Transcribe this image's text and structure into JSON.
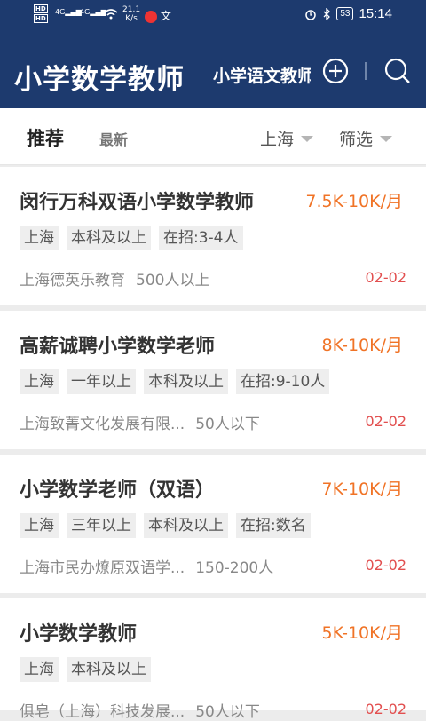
{
  "status_bar": {
    "hd1": "HD",
    "hd2": "HD",
    "signal1": "4G",
    "signal2": "4G",
    "speed_value": "21.1",
    "speed_unit": "K/s",
    "battery": "53",
    "time": "15:14"
  },
  "header": {
    "title": "小学数学教师",
    "subtab": "小学语文教师"
  },
  "filters": {
    "tab_recommend": "推荐",
    "tab_latest": "最新",
    "city": "上海",
    "filter": "筛选"
  },
  "jobs": [
    {
      "title": "闵行万科双语小学数学教师",
      "salary": "7.5K-10K/月",
      "tags": [
        "上海",
        "本科及以上",
        "在招:3-4人"
      ],
      "company": "上海德英乐教育",
      "size": "500人以上",
      "date": "02-02"
    },
    {
      "title": "高薪诚聘小学数学老师",
      "salary": "8K-10K/月",
      "tags": [
        "上海",
        "一年以上",
        "本科及以上",
        "在招:9-10人"
      ],
      "company": "上海致菁文化发展有限...",
      "size": "50人以下",
      "date": "02-02"
    },
    {
      "title": "小学数学老师（双语）",
      "salary": "7K-10K/月",
      "tags": [
        "上海",
        "三年以上",
        "本科及以上",
        "在招:数名"
      ],
      "company": "上海市民办燎原双语学...",
      "size": "150-200人",
      "date": "02-02"
    },
    {
      "title": "小学数学教师",
      "salary": "5K-10K/月",
      "tags": [
        "上海",
        "本科及以上"
      ],
      "company": "俱皂（上海）科技发展...",
      "size": "50人以下",
      "date": "02-02"
    }
  ]
}
